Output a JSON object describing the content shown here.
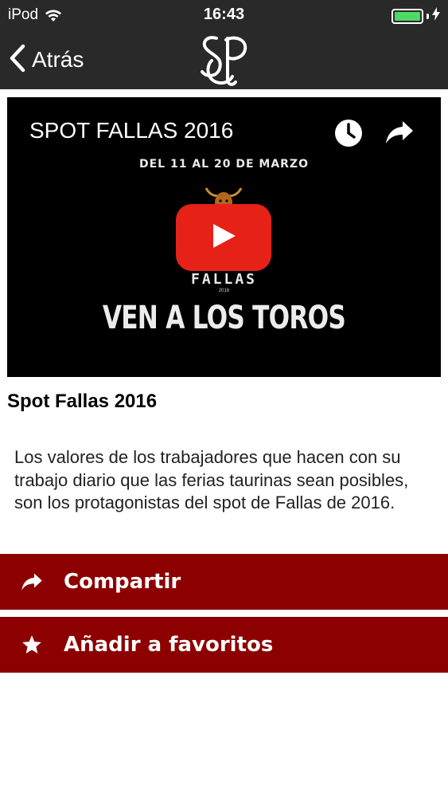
{
  "status_bar": {
    "carrier": "iPod",
    "time": "16:43",
    "wifi_icon": "wifi-icon",
    "battery_icon": "battery-full-icon",
    "charging_icon": "bolt-icon"
  },
  "nav": {
    "back_label": "Atrás",
    "back_icon": "chevron-left-icon",
    "logo": "SP monogram logo"
  },
  "video": {
    "title": "SPOT FALLAS 2016",
    "poster_dates": "DEL 11 AL 20 DE MARZO",
    "poster_event": "FALLAS",
    "poster_year": "2016",
    "poster_tagline": "VEN A LOS TOROS",
    "icons": [
      "clock-icon",
      "share-arrow-icon",
      "play-icon"
    ]
  },
  "article": {
    "title": "Spot Fallas 2016",
    "description": "Los valores de los trabajadores que hacen con su trabajo diario que las ferias taurinas sean posibles, son los protagonistas del spot de Fallas de 2016."
  },
  "actions": {
    "share_label": "Compartir",
    "share_icon": "share-arrow-icon",
    "favorite_label": "Añadir a favoritos",
    "favorite_icon": "star-icon"
  },
  "colors": {
    "nav_background": "#292929",
    "action_background": "#8c0000",
    "play_button": "#e62117",
    "battery": "#4cd964"
  }
}
